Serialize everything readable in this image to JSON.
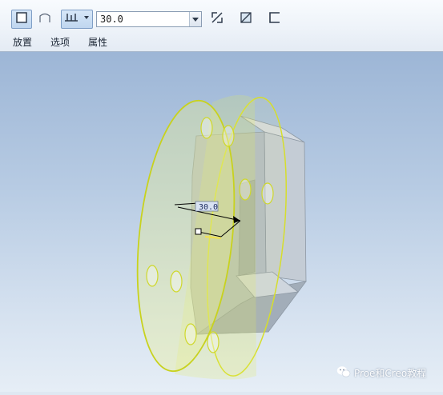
{
  "toolbar": {
    "placement_tab": "放置",
    "options_tab": "选项",
    "properties_tab": "属性",
    "depth_value": "30.0",
    "icons": {
      "solid": "solid-extrude-icon",
      "surface": "surface-extrude-icon",
      "depth_type": "blind-depth-icon",
      "flip": "flip-direction-icon",
      "remove_material": "remove-material-icon",
      "thicken": "thicken-sketch-icon"
    },
    "accent": "#7e9ec6"
  },
  "viewport": {
    "dimension_label": "30.0",
    "model_color": "#e8f07a",
    "block_color": "#b7c1cb"
  },
  "watermark": {
    "text": "Proe和Creo教程"
  }
}
